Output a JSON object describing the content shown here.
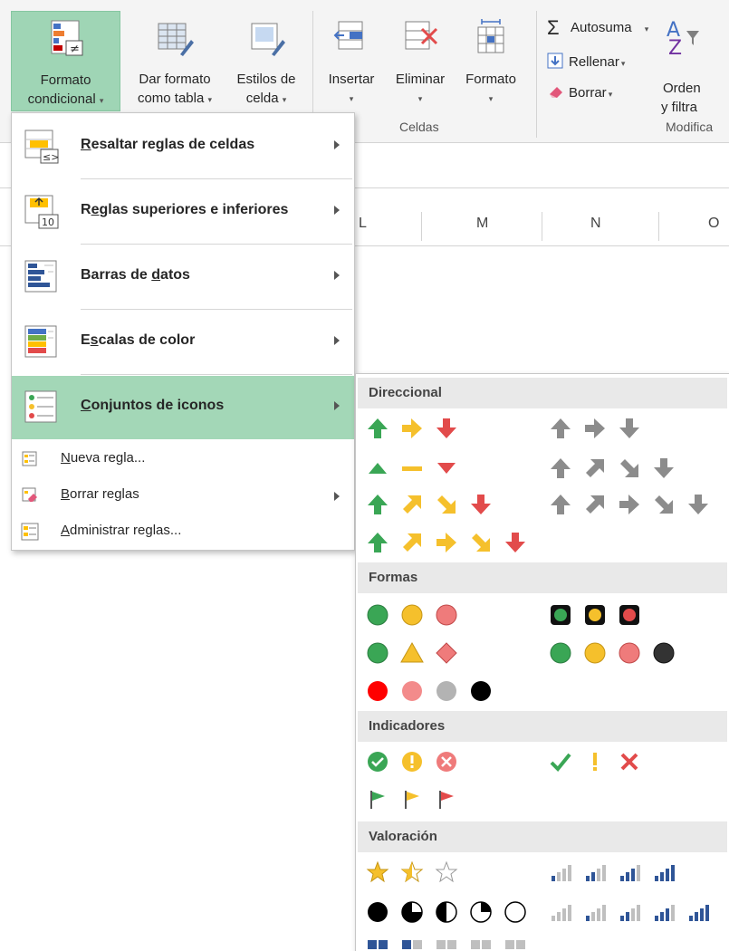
{
  "ribbon": {
    "buttons": {
      "conditional_formatting": [
        "Formato",
        "condicional"
      ],
      "format_as_table": [
        "Dar formato",
        "como tabla"
      ],
      "cell_styles": [
        "Estilos de",
        "celda"
      ],
      "insert": "Insertar",
      "delete": "Eliminar",
      "format": "Formato"
    },
    "groups": {
      "cells": "Celdas",
      "editing": "Modifica"
    },
    "editing": {
      "autosum": "Autosuma",
      "fill": "Rellenar",
      "clear": "Borrar",
      "sort_filter": [
        "Orden",
        "y filtra"
      ]
    }
  },
  "sheet": {
    "columns": [
      "L",
      "M",
      "N",
      "O"
    ]
  },
  "menu": {
    "items": [
      {
        "label": "Resaltar reglas de celdas",
        "accel": "R",
        "rest": "esaltar reglas de celdas"
      },
      {
        "label": "Reglas superiores e inferiores",
        "pre": "R",
        "accel": "e",
        "rest": "glas superiores e inferiores"
      },
      {
        "label": "Barras de datos",
        "pre": "Barras de ",
        "accel": "d",
        "rest": "atos"
      },
      {
        "label": "Escalas de color",
        "pre": "E",
        "accel": "s",
        "rest": "calas de color"
      },
      {
        "label": "Conjuntos de iconos",
        "pre": "",
        "accel": "C",
        "rest": "onjuntos de iconos"
      }
    ],
    "small_items": [
      {
        "label": "Nueva regla...",
        "accel": "N",
        "rest": "ueva regla..."
      },
      {
        "label": "Borrar reglas",
        "accel": "B",
        "rest": "orrar reglas"
      },
      {
        "label": "Administrar reglas...",
        "accel": "A",
        "rest": "dministrar reglas..."
      }
    ]
  },
  "icon_sets": {
    "sections": [
      "Direccional",
      "Formas",
      "Indicadores",
      "Valoración"
    ]
  },
  "colors": {
    "menu_highlight": "#a3d7b7",
    "ribbon_active": "#9fd5b5",
    "green": "#3aa655",
    "yellow": "#f5c02c",
    "red": "#e24b4b",
    "gray": "#8c8c8c",
    "bar_blue": "#2f5597"
  }
}
